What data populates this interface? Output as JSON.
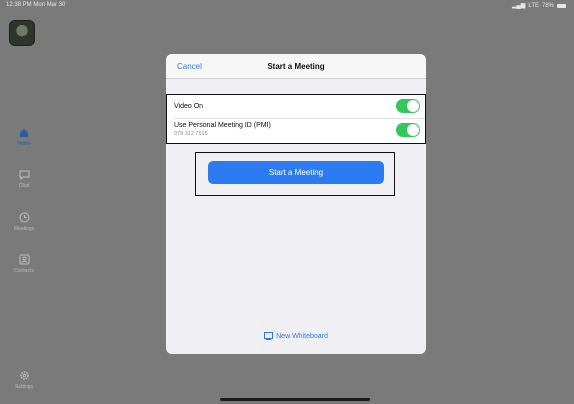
{
  "status_bar": {
    "time": "12:38 PM  Mon Mar 30",
    "network": "LTE",
    "battery": "78%"
  },
  "sidebar": {
    "items": [
      {
        "label": "Home",
        "icon": "home-icon",
        "active": true
      },
      {
        "label": "Chat",
        "icon": "chat-icon",
        "active": false
      },
      {
        "label": "Meetings",
        "icon": "clock-icon",
        "active": false
      },
      {
        "label": "Contacts",
        "icon": "contacts-icon",
        "active": false
      },
      {
        "label": "Settings",
        "icon": "gear-icon",
        "active": false
      }
    ]
  },
  "dialog": {
    "title": "Start a Meeting",
    "cancel_label": "Cancel",
    "video_on_label": "Video On",
    "video_on": true,
    "pmi_label": "Use Personal Meeting ID (PMI)",
    "pmi_number": "979 312 7515",
    "pmi_on": true,
    "start_button_label": "Start a Meeting",
    "whiteboard_label": "New Whiteboard"
  },
  "colors": {
    "accent": "#2d7bf0",
    "toggle_on": "#34c759",
    "active_nav": "#2a5ba8"
  }
}
